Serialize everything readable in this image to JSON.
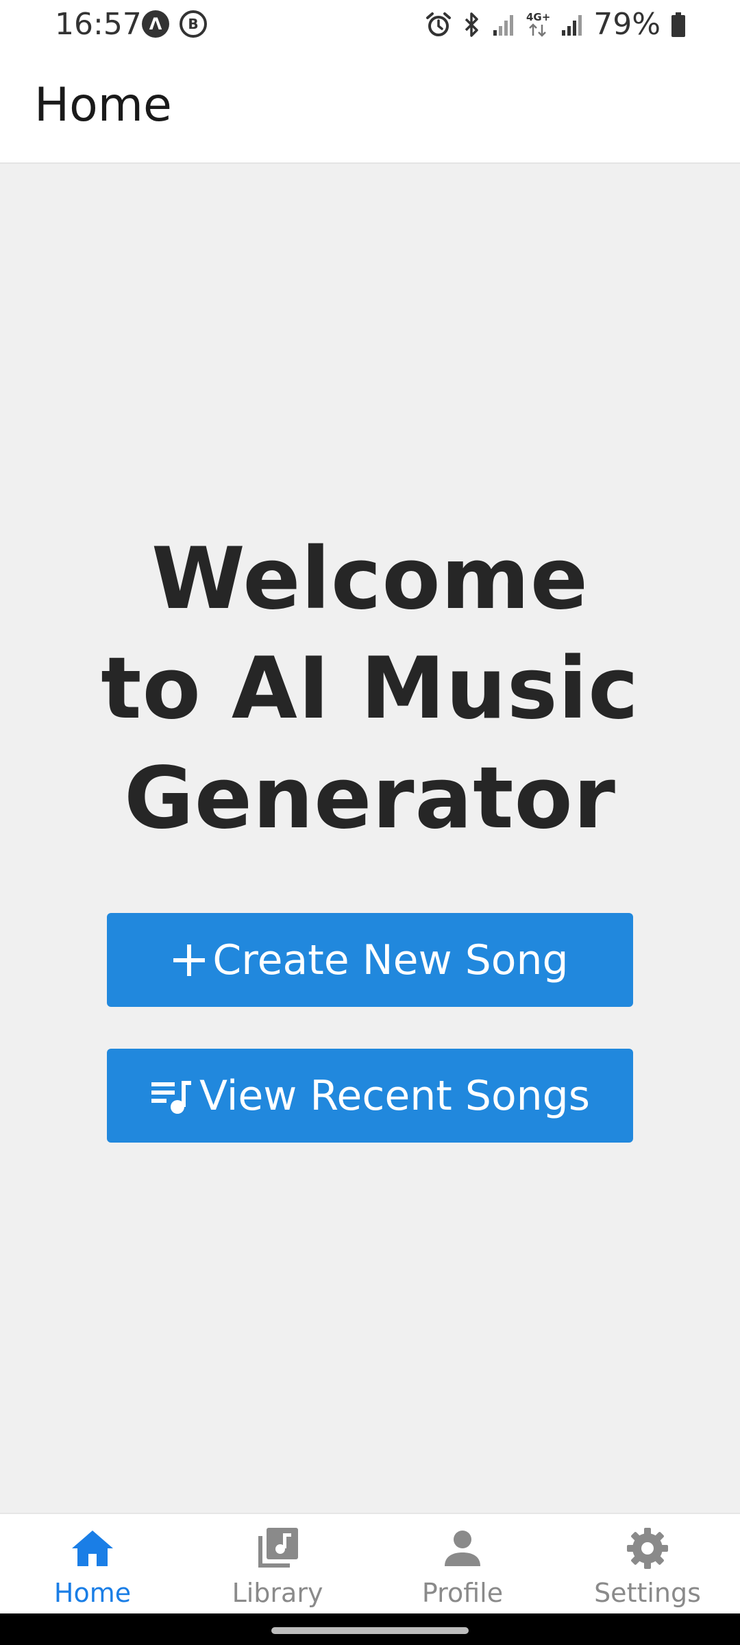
{
  "status_bar": {
    "time": "16:57",
    "battery": "79%",
    "network": "4G+",
    "icons": [
      "notification-a-icon",
      "notification-b-icon",
      "alarm-icon",
      "bluetooth-icon",
      "signal-icon",
      "data-arrows-icon",
      "battery-icon"
    ]
  },
  "app_bar": {
    "title": "Home"
  },
  "main": {
    "welcome_title": "Welcome to AI Music Generator",
    "create_button": {
      "label": "Create New Song",
      "icon": "plus-icon"
    },
    "recent_button": {
      "label": "View Recent Songs",
      "icon": "playlist-music-icon"
    }
  },
  "bottom_nav": {
    "active_color": "#1a7ee6",
    "inactive_color": "#8a8a8a",
    "items": [
      {
        "label": "Home",
        "icon": "home-icon",
        "active": true
      },
      {
        "label": "Library",
        "icon": "library-icon",
        "active": false
      },
      {
        "label": "Profile",
        "icon": "person-icon",
        "active": false
      },
      {
        "label": "Settings",
        "icon": "gear-icon",
        "active": false
      }
    ]
  },
  "colors": {
    "primary_button": "#2188dd",
    "background": "#f0f0f0"
  }
}
